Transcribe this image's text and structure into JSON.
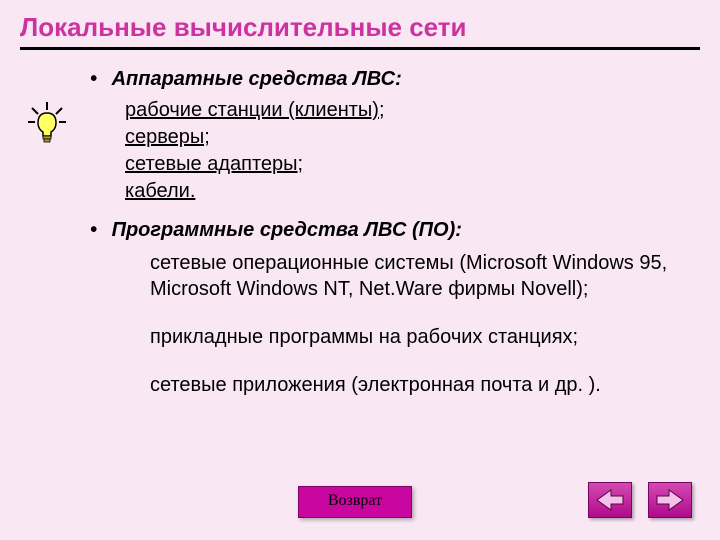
{
  "title": "Локальные вычислительные сети",
  "bullet_glyph": "•",
  "section1": {
    "heading": "Аппаратные средства ЛВС:",
    "items": [
      "рабочие станции (клиенты);",
      "серверы;",
      "сетевые адаптеры;",
      "кабели."
    ]
  },
  "section2": {
    "heading": "Программные средства ЛВС (ПО):",
    "items": [
      "сетевые операционные системы (Microsoft Windows 95, Microsoft Windows NT, Net.Ware фирмы Novell);",
      "прикладные программы на рабочих станциях;",
      "сетевые приложения (электронная почта и др. )."
    ]
  },
  "buttons": {
    "return": "Возврат"
  },
  "icons": {
    "decor": "lightbulb-icon",
    "prev": "arrow-left-icon",
    "next": "arrow-right-icon"
  }
}
